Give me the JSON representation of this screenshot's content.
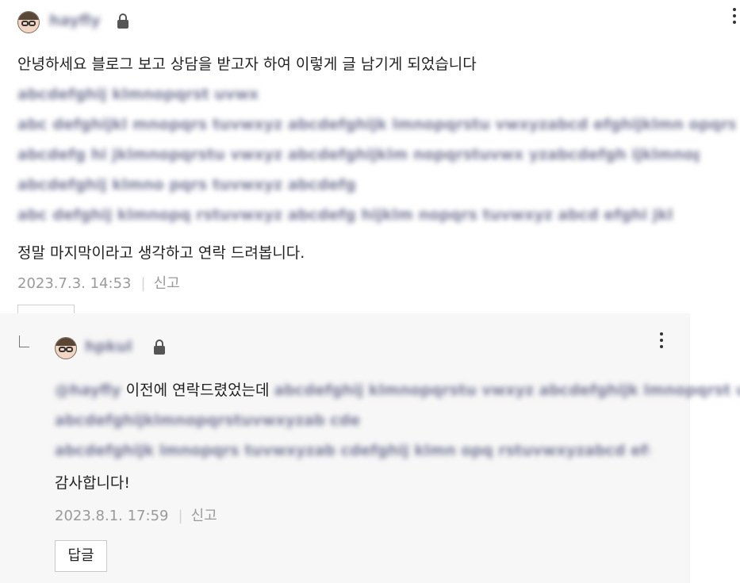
{
  "comment": {
    "author_name": "hayfly",
    "body_line1": "안녕하세요 블로그 보고 상담을 받고자 하여 이렇게 글 남기게 되었습니다",
    "blurred_lines": [
      "abcdefghij klmnopqrst uvwx",
      "abc defghijkl mnopqrs tuvwxyz abcdefghijk lmnopqrstu vwxyzabcd efghijklmn opqrstu vwxyzab cde",
      "abcdefg hi jklmnopqrstu vwxyz abcdefghijklm nopqrstuvwx yzabcdefgh ijklmnop qrstu vwxyz abc",
      "abcdefghij klmno pqrs tuvwxyz abcdefg",
      "abc defghij klmnopq rstuvwxyz abcdefg hijklm nopqrs tuvwxyz abcd efghi jklmno pq"
    ],
    "body_last": "정말 마지막이라고 생각하고 연락 드려봅니다.",
    "timestamp": "2023.7.3. 14:53",
    "report_label": "신고"
  },
  "reply": {
    "author_name": "hpkul",
    "mention": "@hayfly",
    "line1_text": " 이전에 연락드렸었는데 ",
    "blurred_line1_tail": "abcdefghij klmnopqrstu vwxyz abcdefghijk lmnopqrst uv w",
    "blurred_lines": [
      "abcdefghijklmnopqrstuvwxyzab cde",
      "abcdefghijk lmnopqrs tuvwxyzab cdefghij klmn opq rstuvwxyzabcd efg"
    ],
    "body_last": "감사합니다!",
    "timestamp": "2023.8.1. 17:59",
    "report_label": "신고",
    "reply_button_label": "답글"
  },
  "icons": {
    "avatar": "avatar-icon",
    "lock": "lock-icon",
    "more": "more-vertical-icon",
    "reply_arrow": "reply-arrow-icon"
  },
  "colors": {
    "reply_background": "#f7f7f7",
    "meta_text": "#9a9a9a",
    "text": "#222222"
  }
}
